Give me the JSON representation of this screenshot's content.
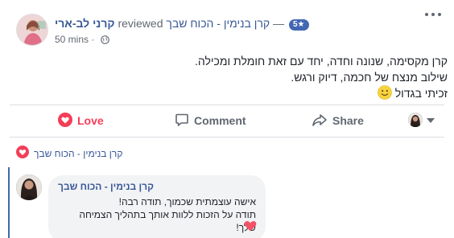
{
  "post": {
    "author": "קרני לב-ארי",
    "reviewed_word": "reviewed",
    "page_name": "קרן בנימין - הכוח שבך",
    "rating": "5",
    "dash": "—",
    "time": "50 mins",
    "separator": "·",
    "lines": [
      "קרן מקסימה, שנונה וחדה, יחד עם זאת חומלת ומכילה.",
      "שילוב מנצח של חכמה, דיוק ורגש.",
      "זכיתי בגדול"
    ]
  },
  "actions": {
    "love": "Love",
    "comment": "Comment",
    "share": "Share"
  },
  "reactions": {
    "reactor_name": "קרן בנימין - הכוח שבך"
  },
  "comment": {
    "author": "קרן בנימין - הכוח שבך",
    "lines": [
      "אישה עוצמתית שכמוך, תודה רבה!",
      "תודה על הזכות ללוות אותך בתהליך הצמיחה שלך!"
    ]
  },
  "colors": {
    "link": "#385898",
    "love": "#f33e58",
    "rating_badge": "#4267b2",
    "bubble": "#f2f3f5"
  },
  "icons": [
    "more-icon",
    "globe-icon",
    "star-icon",
    "smile-emoji",
    "heart-icon",
    "comment-icon",
    "share-icon",
    "chevron-down-icon",
    "love-reaction-icon"
  ]
}
